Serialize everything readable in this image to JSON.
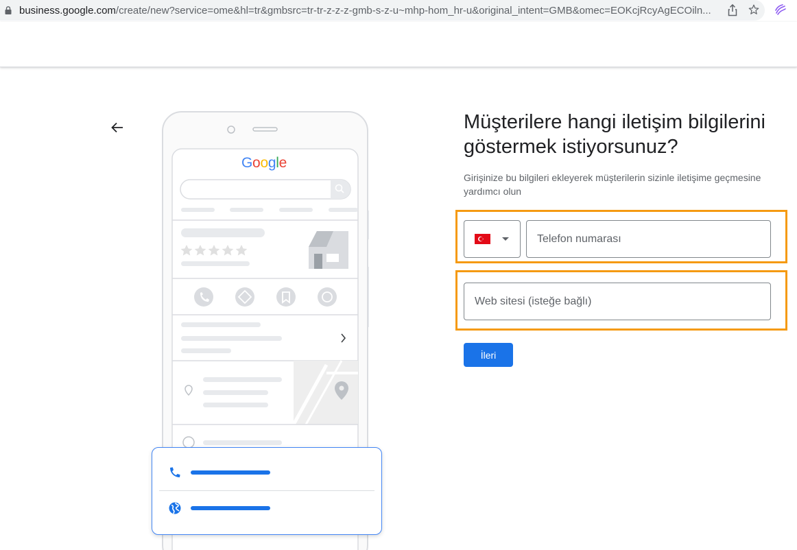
{
  "browser": {
    "url_host": "business.google.com",
    "url_rest": "/create/new?service=ome&hl=tr&gmbsrc=tr-tr-z-z-z-gmb-s-z-u~mhp-hom_hr-u&original_intent=GMB&omec=EOKcjRcyAgECOiln...",
    "icons": [
      "lock-icon",
      "share-icon",
      "bookmark-star-icon",
      "extension-icon"
    ]
  },
  "illustration": {
    "google_logo": "Google",
    "colors": {
      "blue": "#4285F4",
      "red": "#EA4335",
      "yellow": "#FBBC05",
      "green": "#34A853"
    }
  },
  "form": {
    "title": "Müşterilere hangi iletişim bilgilerini göstermek istiyorsunuz?",
    "subtitle": "Girişinize bu bilgileri ekleyerek müşterilerin sizinle iletişime geçmesine yardımcı olun",
    "country_flag": "TR",
    "phone_placeholder": "Telefon numarası",
    "website_placeholder": "Web sitesi (isteğe bağlı)",
    "next_label": "İleri"
  },
  "colors": {
    "accent": "#1a73e8",
    "highlight": "#f59a12"
  }
}
